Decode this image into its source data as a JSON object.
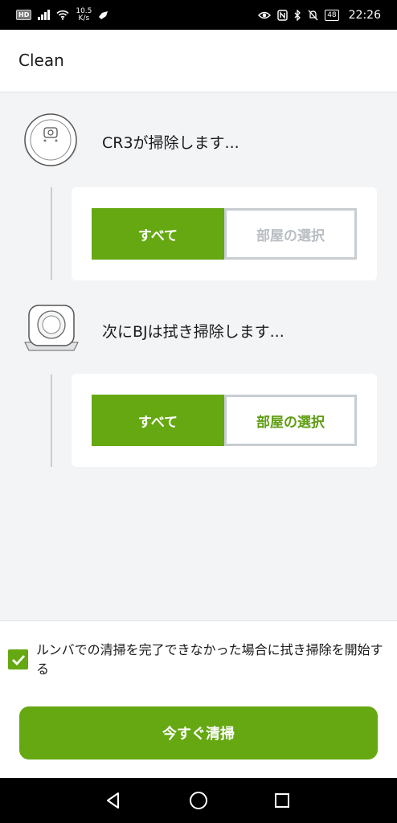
{
  "status_bar": {
    "hd": "HD",
    "net_speed_value": "10.5",
    "net_speed_unit": "K/s",
    "battery": "48",
    "time": "22:26"
  },
  "header": {
    "title": "Clean"
  },
  "robots": [
    {
      "icon": "roomba-robot-icon",
      "message": "CR3が掃除します...",
      "all_label": "すべて",
      "select_rooms_label": "部屋の選択",
      "select_rooms_enabled": false
    },
    {
      "icon": "braava-mop-robot-icon",
      "message": "次にBJは拭き掃除します...",
      "all_label": "すべて",
      "select_rooms_label": "部屋の選択",
      "select_rooms_enabled": true
    }
  ],
  "bottom": {
    "checkbox_checked": true,
    "checkbox_label": "ルンバでの清掃を完了できなかった場合に拭き掃除を開始する",
    "start_button": "今すぐ清掃"
  },
  "colors": {
    "accent_green": "#65a811",
    "background": "#f2f4f6",
    "disabled_text": "#b9bec3"
  }
}
